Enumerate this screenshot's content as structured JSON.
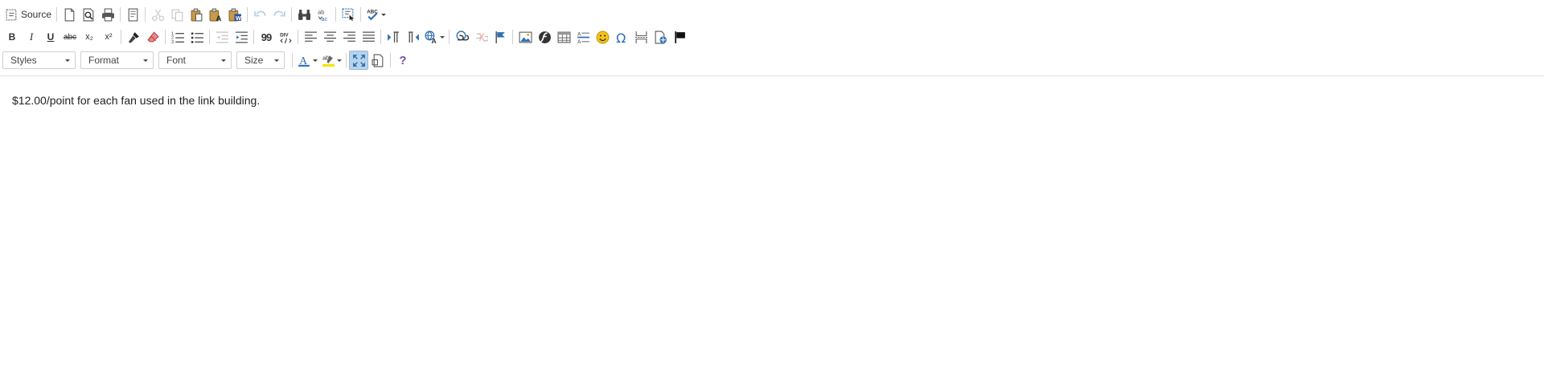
{
  "toolbar": {
    "source_label": "Source",
    "bold_label": "B",
    "italic_label": "I",
    "underline_label": "U",
    "strike_label": "abc",
    "subscript_label": "x₂",
    "superscript_label": "x²",
    "blockquote_label": "99",
    "combos": {
      "styles": "Styles",
      "format": "Format",
      "font": "Font",
      "size": "Size"
    },
    "help_label": "?",
    "colors": {
      "accent": "#2f6fb5",
      "disabled": "#b9b9b9",
      "highlight": "#f5e400",
      "active_bg": "#b7d3ec"
    }
  },
  "content": {
    "text": "$12.00/point for each fan used in the link building."
  }
}
